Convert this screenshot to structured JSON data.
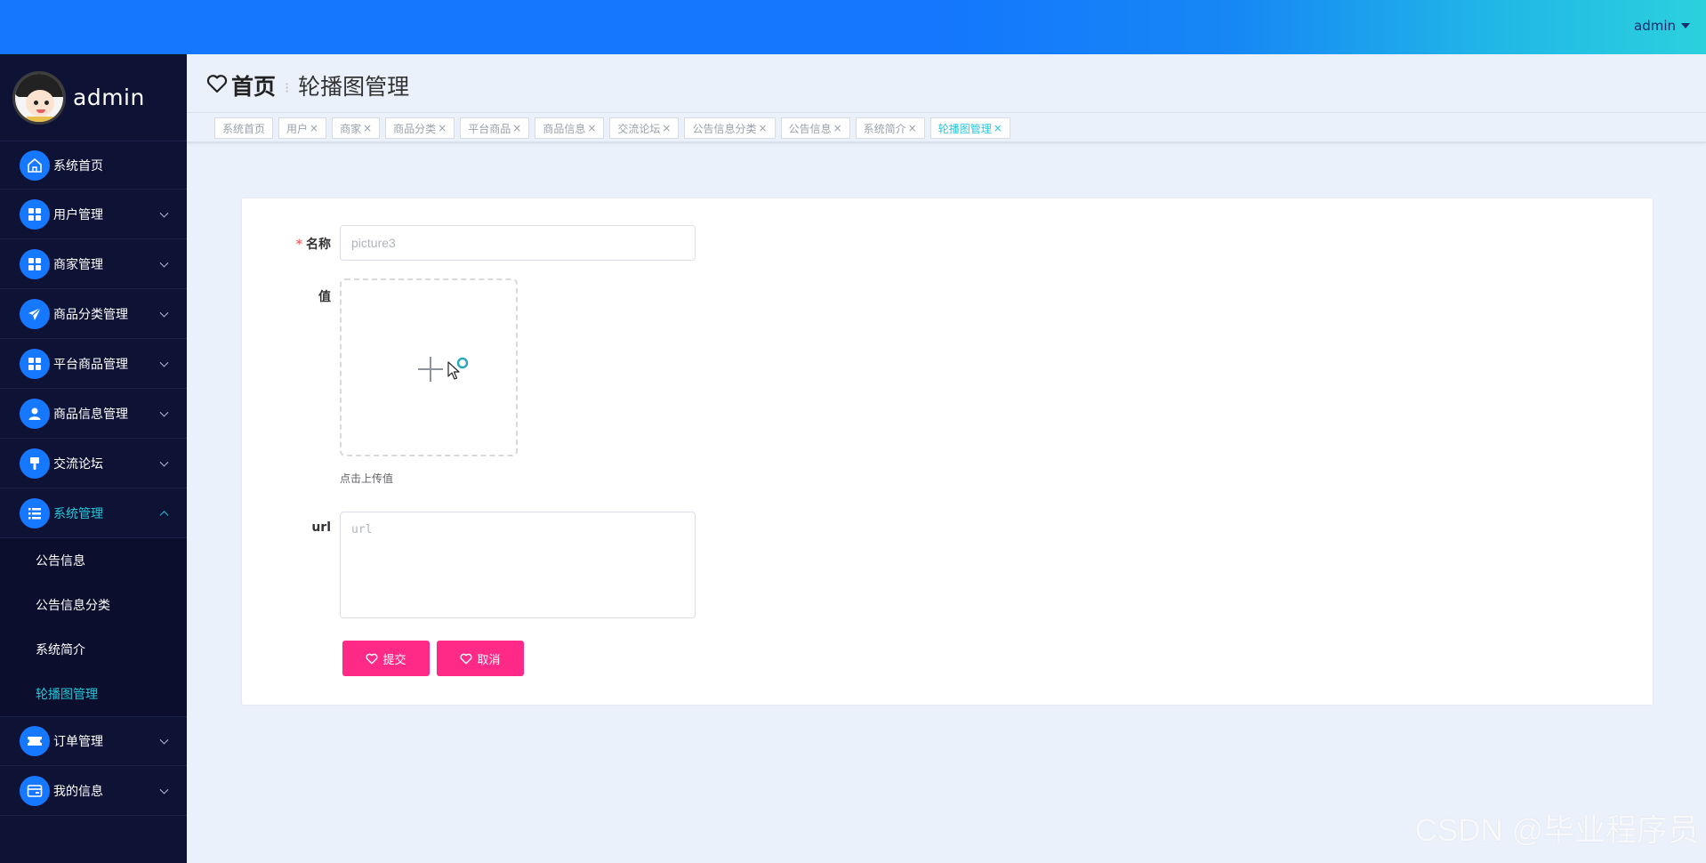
{
  "topbar": {
    "user_label": "admin"
  },
  "profile": {
    "name": "admin"
  },
  "sidebar": {
    "items": [
      {
        "label": "系统首页",
        "icon": "home-icon",
        "expandable": false
      },
      {
        "label": "用户管理",
        "icon": "grid-icon",
        "expandable": true
      },
      {
        "label": "商家管理",
        "icon": "grid-icon",
        "expandable": true
      },
      {
        "label": "商品分类管理",
        "icon": "paper-plane-icon",
        "expandable": true
      },
      {
        "label": "平台商品管理",
        "icon": "grid-icon",
        "expandable": true
      },
      {
        "label": "商品信息管理",
        "icon": "user-icon",
        "expandable": true
      },
      {
        "label": "交流论坛",
        "icon": "brush-icon",
        "expandable": true
      },
      {
        "label": "系统管理",
        "icon": "list-icon",
        "expandable": true,
        "open": true
      },
      {
        "label": "订单管理",
        "icon": "ticket-icon",
        "expandable": true
      },
      {
        "label": "我的信息",
        "icon": "card-icon",
        "expandable": true
      }
    ],
    "system_sub": [
      "公告信息",
      "公告信息分类",
      "系统简介",
      "轮播图管理"
    ],
    "active_sub": "轮播图管理"
  },
  "breadcrumb": {
    "home": "首页",
    "separator": "⁝",
    "current": "轮播图管理"
  },
  "tabs": [
    "系统首页",
    "用户",
    "商家",
    "商品分类",
    "平台商品",
    "商品信息",
    "交流论坛",
    "公告信息分类",
    "公告信息",
    "系统简介",
    "轮播图管理"
  ],
  "active_tab": "轮播图管理",
  "tab_close": "×",
  "form": {
    "name_label": "名称",
    "name_required_mark": "*",
    "name_value": "picture3",
    "value_label": "值",
    "upload_tip": "点击上传值",
    "url_label": "url",
    "url_placeholder": "url",
    "submit_label": "提交",
    "cancel_label": "取消"
  },
  "colors": {
    "primary": "#1677ff",
    "accent": "#26c7d9",
    "button": "#ff2a88",
    "sidebar_bg": "#0e1335"
  },
  "watermark": "CSDN @毕业程序员"
}
